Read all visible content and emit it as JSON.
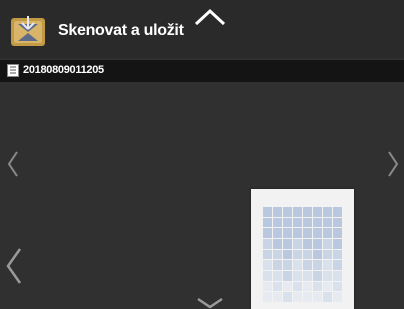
{
  "header": {
    "title": "Skenovat a uložit",
    "app_icon": "scan-to-folder-icon",
    "scroll_up_icon": "chevron-up-icon"
  },
  "file": {
    "icon": "document-icon",
    "name": "20180809011205"
  },
  "navigation": {
    "previous_icon": "chevron-left-icon",
    "next_icon": "chevron-right-icon",
    "scroll_down_icon": "chevron-down-icon"
  },
  "colors": {
    "background": "#303030",
    "header": "#2a2a2a",
    "file_bar": "#141414",
    "text": "#ffffff"
  }
}
